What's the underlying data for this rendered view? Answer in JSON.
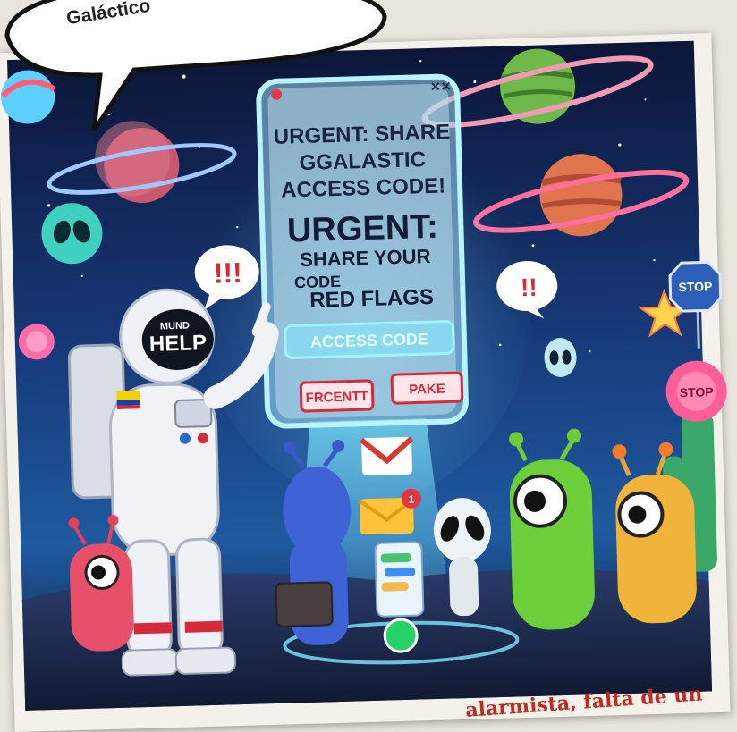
{
  "speech_bubble": {
    "text": "Galáctico"
  },
  "phone": {
    "title_lines": [
      "URGENT: SHARE",
      "GGALASTIC",
      "ACCESS CODE!"
    ],
    "urgent_line": "URGENT:",
    "share_line": "SHARE YOUR",
    "code_line": "CODE",
    "red_flags": "RED FLAGS",
    "access_button": "ACCESS CODE",
    "left_button": "FRCENTT",
    "right_button": "PAKE",
    "close_marks": "✕✕"
  },
  "helmet_text": {
    "top": "MUND",
    "main": "HELP"
  },
  "alerts": {
    "left": "!!!",
    "right": "!!"
  },
  "signs": {
    "right_sign": "STOP",
    "flower_sign": "STOP"
  },
  "notification_badge": "1",
  "caption": "alarmista, falta de un",
  "colors": {
    "sky_top": "#0e1a44",
    "sky_glow": "#3aa7e6",
    "neon_cyan": "#7fe9ff",
    "alert_red": "#d62a3a",
    "caption_red": "#c02a22"
  }
}
